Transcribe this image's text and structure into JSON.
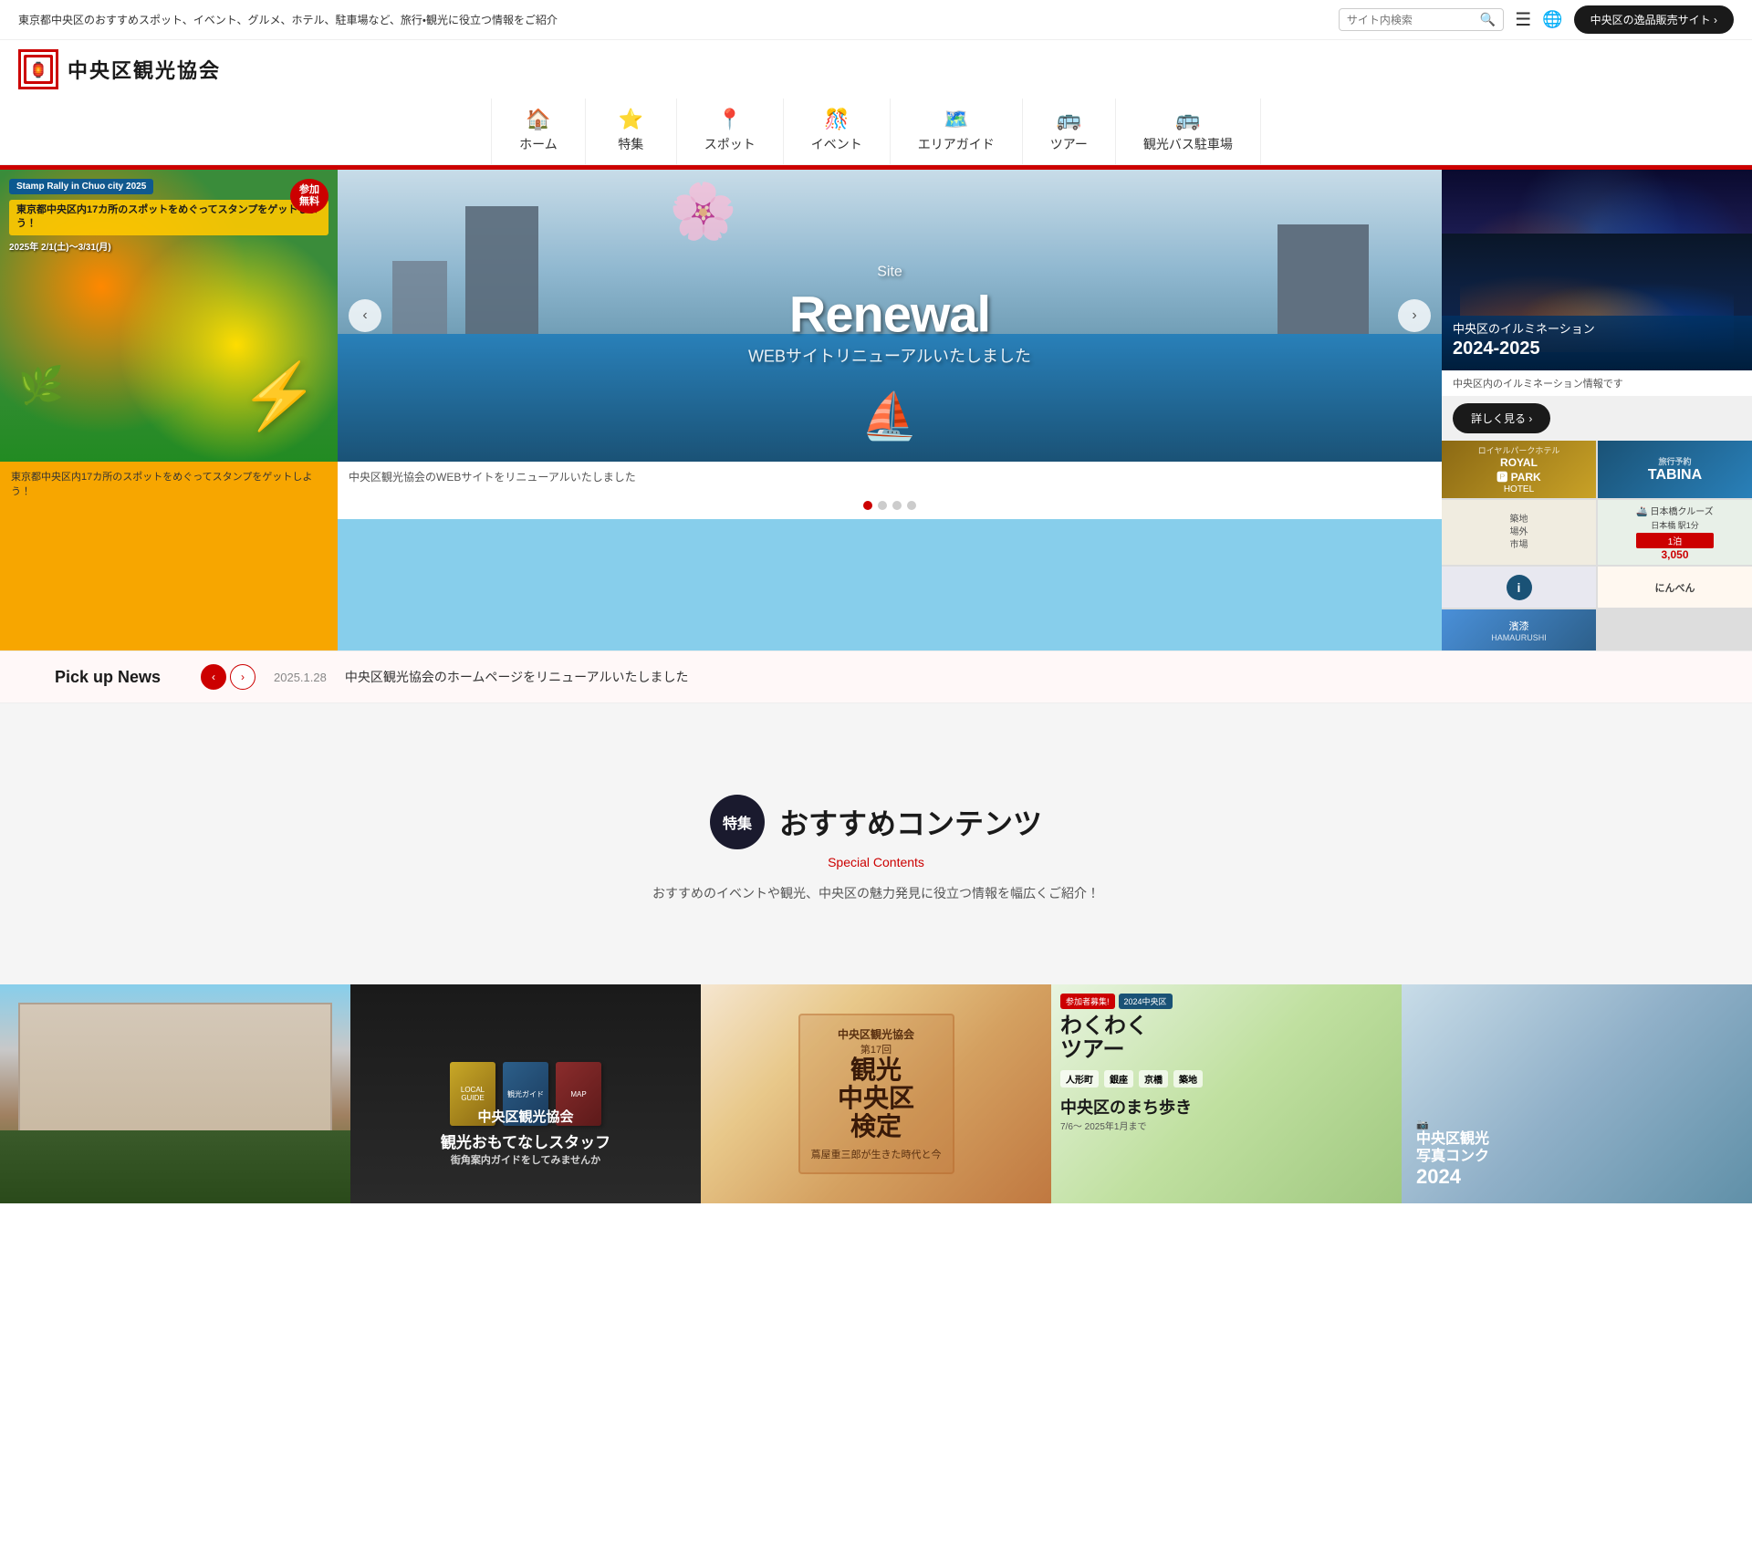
{
  "topbar": {
    "tagline": "東京都中央区のおすすめスポット、イベント、グルメ、ホテル、駐車場など、旅行・観光に役立つ情報をご紹介",
    "search_placeholder": "サイト内検索",
    "shop_button": "中央区の逸品販売サイト"
  },
  "logo": {
    "icon_text": "🏮",
    "title": "中央区観光協会"
  },
  "nav": {
    "items": [
      {
        "id": "home",
        "icon": "🏠",
        "label": "ホーム"
      },
      {
        "id": "tokushu",
        "icon": "⭐",
        "label": "特集"
      },
      {
        "id": "spot",
        "icon": "📍",
        "label": "スポット"
      },
      {
        "id": "event",
        "icon": "🎊",
        "label": "イベント"
      },
      {
        "id": "area",
        "icon": "🗺️",
        "label": "エリアガイド"
      },
      {
        "id": "tour",
        "icon": "🚌",
        "label": "ツアー"
      },
      {
        "id": "bus",
        "icon": "🚌",
        "label": "観光バス駐車場"
      }
    ]
  },
  "hero": {
    "left": {
      "badge_text": "Stamp Rally in Chuo city 2025",
      "caption": "東京都中央区内17カ所のスポットをめぐってスタンプをゲットしよう！"
    },
    "center": {
      "site_label": "Site",
      "renewal_text": "Renewal",
      "subtitle": "WEBサイトリニューアルいたしました",
      "caption": "中央区観光協会のWEBサイトをリニューアルいたしました",
      "dots": [
        true,
        false,
        false,
        false
      ]
    },
    "right": {
      "illumination_label": "中央区のイルミネーション",
      "illumination_year": "2024-2025",
      "caption": "中央区内のイルミネーション情報です",
      "more_button": "詳しく見る",
      "ads": [
        {
          "id": "royal-park",
          "text": "ROYAL PARK HOTEL",
          "class": "ad-royal"
        },
        {
          "id": "tabina",
          "text": "TABINA",
          "class": "ad-tabina"
        },
        {
          "id": "spot2",
          "text": "築\n地\n場\n外\n市\n場",
          "class": "ad-spot"
        },
        {
          "id": "nihon",
          "text": "日本クルーズ",
          "class": "ad-nihon"
        },
        {
          "id": "info",
          "text": "i",
          "class": "ad-info"
        },
        {
          "id": "nanbei",
          "text": "にんべん",
          "class": "ad-nanbei"
        },
        {
          "id": "haze",
          "text": "濱漆",
          "class": "ad-haze"
        }
      ]
    }
  },
  "pickup_news": {
    "label": "Pick up News",
    "prev_label": "‹",
    "next_label": "›",
    "date": "2025.1.28",
    "content": "中央区観光協会のホームページをリニューアルいたしました"
  },
  "featured": {
    "badge_text": "特集",
    "title": "おすすめコンテンツ",
    "subtitle": "Special Contents",
    "description": "おすすめのイベントや観光、中央区の魅力発見に役立つ情報を幅広くご紹介！",
    "cards": [
      {
        "id": "card-building",
        "type": "building",
        "overlay_text": ""
      },
      {
        "id": "card-staff",
        "type": "guides",
        "title": "中央区観光協会",
        "subtitle": "観光おもてなしスタッフ",
        "detail": "街角案内ガイドをしてみませんか"
      },
      {
        "id": "card-kentei",
        "type": "kanko",
        "title": "第17回 観光中央区検定",
        "subtitle": "蔦屋重三郎が生きた時代と今"
      },
      {
        "id": "card-wakuwaku",
        "type": "wakuwaku",
        "title": "2024中央区 わくわくツアー",
        "subtitle": "中央区のまち歩き"
      },
      {
        "id": "card-photo",
        "type": "photo",
        "title": "中央区観光 写真コンク",
        "subtitle": "2024"
      }
    ]
  }
}
